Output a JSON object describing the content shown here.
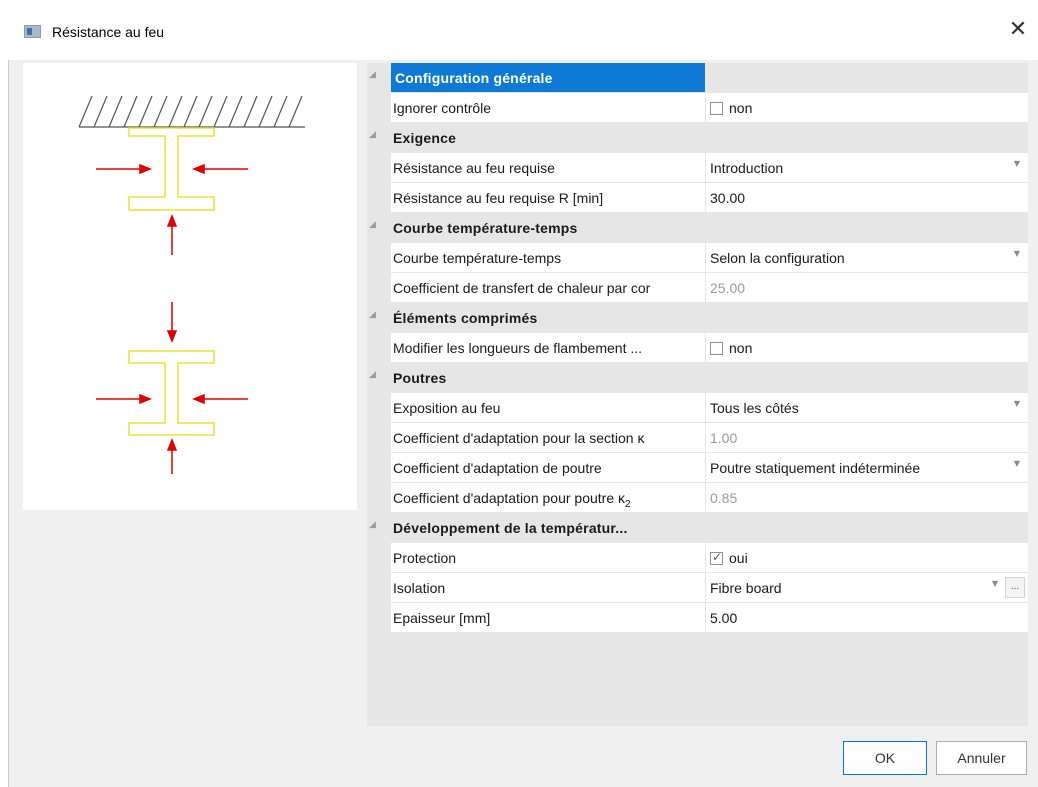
{
  "window": {
    "title": "Résistance au feu",
    "close_glyph": "✕",
    "icon": "app-icon"
  },
  "property_grid": {
    "groups": [
      {
        "title": "Configuration générale",
        "selected": true,
        "rows": [
          {
            "label": "Ignorer contrôle",
            "type": "checkbox",
            "checked": false,
            "value": "non"
          }
        ]
      },
      {
        "title": "Exigence",
        "rows": [
          {
            "label": "Résistance au feu requise",
            "type": "dropdown",
            "value": "Introduction"
          },
          {
            "label": "Résistance au feu requise R [min]",
            "type": "text",
            "value": "30.00"
          }
        ]
      },
      {
        "title": "Courbe température-temps",
        "rows": [
          {
            "label": "Courbe température-temps",
            "type": "dropdown",
            "value": "Selon la configuration"
          },
          {
            "label": "Coefficient de transfert de chaleur par cor",
            "type": "text",
            "disabled": true,
            "value": "25.00"
          }
        ]
      },
      {
        "title": "Éléments comprimés",
        "rows": [
          {
            "label": "Modifier les longueurs de flambement ...",
            "type": "checkbox",
            "checked": false,
            "value": "non"
          }
        ]
      },
      {
        "title": "Poutres",
        "rows": [
          {
            "label": "Exposition au feu",
            "type": "dropdown",
            "value": "Tous les côtés"
          },
          {
            "label": "Coefficient d'adaptation pour la section κ",
            "type": "text",
            "disabled": true,
            "value": "1.00"
          },
          {
            "label": "Coefficient d'adaptation de poutre",
            "type": "dropdown",
            "value": "Poutre statiquement indéterminée"
          },
          {
            "label": "Coefficient d'adaptation pour poutre κ",
            "label_sub": "2",
            "type": "text",
            "disabled": true,
            "value": "0.85"
          }
        ]
      },
      {
        "title": "Développement de la températur...",
        "rows": [
          {
            "label": "Protection",
            "type": "checkbox",
            "checked": true,
            "value": "oui"
          },
          {
            "label": "Isolation",
            "type": "dropdown-more",
            "value": "Fibre board",
            "more_label": "..."
          },
          {
            "label": "Epaisseur [mm]",
            "type": "text",
            "value": "5.00"
          }
        ]
      }
    ]
  },
  "buttons": {
    "ok": "OK",
    "cancel": "Annuler"
  },
  "colors": {
    "selection": "#0f7ad6",
    "arrow_red": "#e00000",
    "section_yellow": "#e8e337"
  }
}
